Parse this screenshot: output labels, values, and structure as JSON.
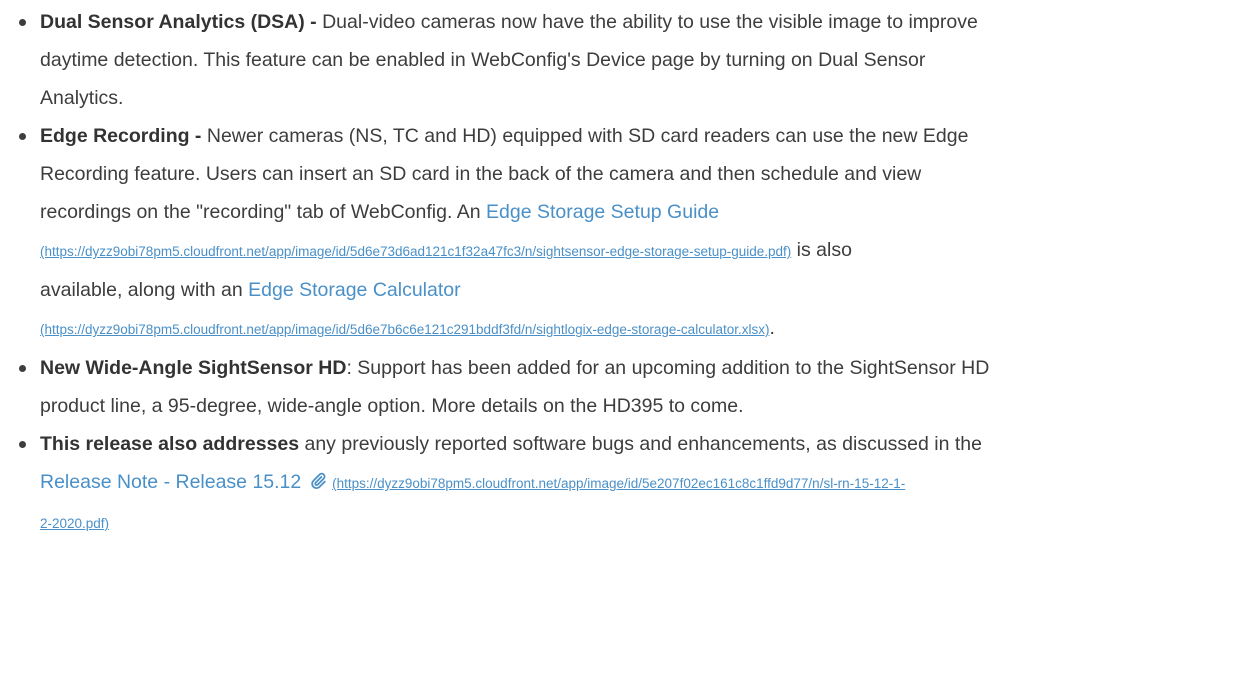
{
  "colors": {
    "text": "#3d3d3d",
    "link": "#4a90c8"
  },
  "features": [
    {
      "label": "Dual Sensor Analytics (DSA) -",
      "lines": [
        " Dual-video cameras now have the ability to use the visible image to improve",
        "daytime detection. This feature can be enabled in WebConfig's Device page by turning on Dual Sensor",
        "Analytics."
      ]
    },
    {
      "label": "Edge Recording -",
      "line1": " Newer cameras (NS, TC and HD) equipped with SD card readers can use the new Edge",
      "line2": "Recording feature. Users can insert an SD card in the back of the camera and then schedule and view",
      "line3": "recordings on the \"recording\" tab of WebConfig.  An ",
      "link1_text": "Edge Storage Setup Guide",
      "link1_url": "(https://dyzz9obi78pm5.cloudfront.net/app/image/id/5d6e73d6ad121c1f32a47fc3/n/sightsensor-edge-storage-setup-guide.pdf)",
      "after_link1": " is also",
      "line6_prefix": "available, along with an ",
      "link2_text": "Edge Storage Calculator",
      "link2_url": "(https://dyzz9obi78pm5.cloudfront.net/app/image/id/5d6e7b6c6e121c291bddf3fd/n/sightlogix-edge-storage-calculator.xlsx)",
      "after_link2": "."
    },
    {
      "label": "New Wide-Angle SightSensor HD",
      "line1": ": Support has been added for an upcoming addition to the SightSensor HD",
      "line2": "product line, a 95-degree, wide-angle option. More details on the HD395 to come."
    },
    {
      "label": "This release also addresses",
      "line1": " any previously reported software bugs and enhancements, as discussed in the",
      "link_text": "Release Note - Release 15.12",
      "link_icon": "paperclip-icon",
      "link_url_part1": "(https://dyzz9obi78pm5.cloudfront.net/app/image/id/5e207f02ec161c8c1ffd9d77/n/sl-rn-15-12-1-",
      "link_url_part2": "2-2020.pdf)"
    }
  ]
}
